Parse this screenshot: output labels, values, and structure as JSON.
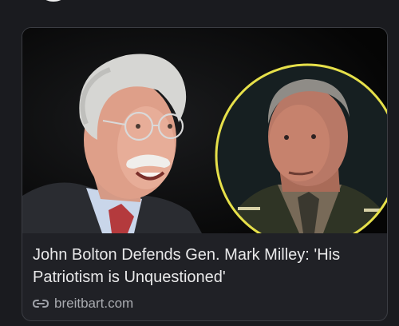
{
  "post": {
    "link_card": {
      "image_description_icon": "news-photo",
      "headline": "John Bolton Defends Gen. Mark Milley: 'His Patriotism is Unquestioned'",
      "source_domain": "breitbart.com",
      "source_icon": "link-icon",
      "highlight_ring_color": "#e6e04a"
    }
  }
}
